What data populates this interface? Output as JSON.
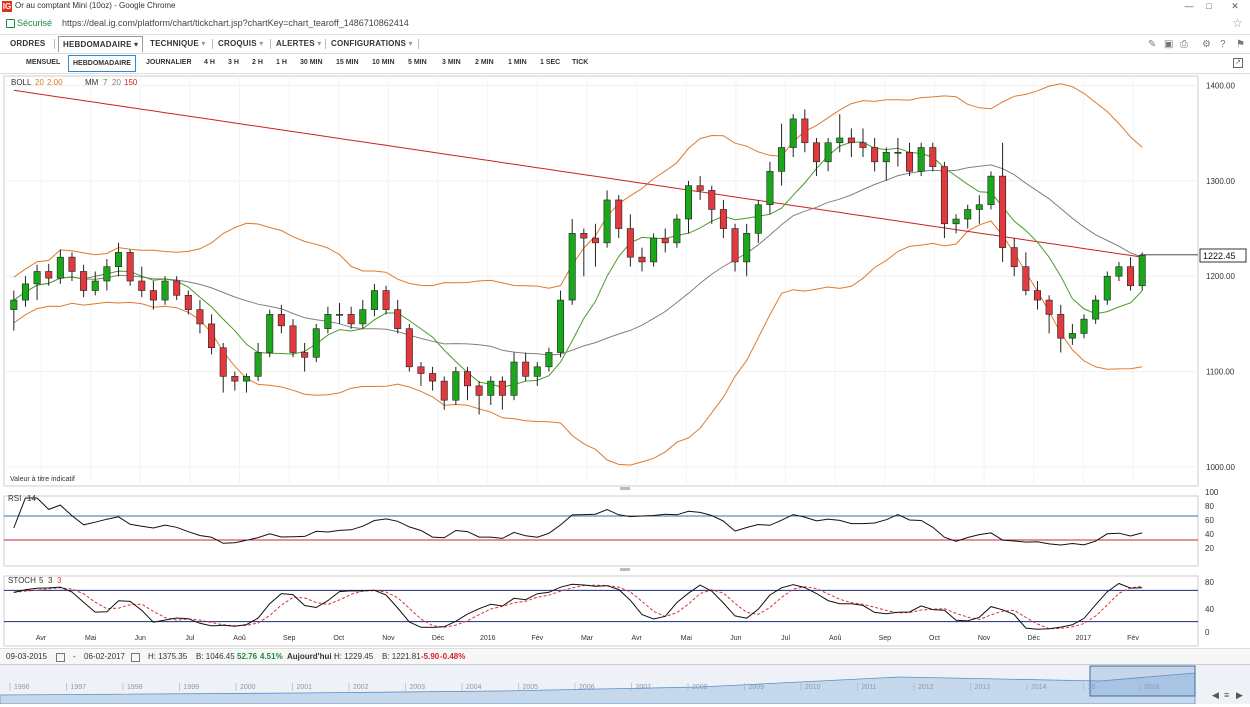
{
  "browser": {
    "title": "Or au comptant Mini (10oz) - Google Chrome",
    "secure_label": "Sécurisé",
    "url": "https://deal.ig.com/platform/chart/tickchart.jsp?chartKey=chart_tearoff_1486710862414",
    "logo": "IG"
  },
  "menu": {
    "items": [
      "ORDRES",
      "HEBDOMADAIRE",
      "TECHNIQUE",
      "CROQUIS",
      "ALERTES",
      "CONFIGURATIONS"
    ],
    "selected": "HEBDOMADAIRE",
    "right_icons": [
      "pencil-icon",
      "image-icon",
      "print-icon",
      "gear-icon",
      "help-icon",
      "comment-icon"
    ]
  },
  "timeframes": {
    "items": [
      "MENSUEL",
      "HEBDOMADAIRE",
      "JOURNALIER",
      "4 H",
      "3 H",
      "2 H",
      "1 H",
      "30 MIN",
      "15 MIN",
      "10 MIN",
      "5 MIN",
      "3 MIN",
      "2 MIN",
      "1 MIN",
      "1 SEC",
      "TICK"
    ],
    "selected": "HEBDOMADAIRE"
  },
  "chart_data": {
    "type": "candlestick",
    "instrument": "Or au comptant Mini (10oz)",
    "period": "weekly",
    "indicators_label": {
      "boll": {
        "name": "BOLL",
        "params": [
          "20",
          "2.00"
        ]
      },
      "mm": {
        "name": "MM",
        "params": [
          "7",
          "20",
          "150"
        ]
      }
    },
    "y_ticks": [
      "1400.00",
      "1300.00",
      "1200.00",
      "1100.00",
      "1000.00"
    ],
    "ylim": [
      980,
      1410
    ],
    "last_price": "1222.45",
    "last_value": 1222.45,
    "x_ticks": [
      "Avr",
      "Mai",
      "Jun",
      "Jul",
      "Aoû",
      "Sep",
      "Oct",
      "Nov",
      "Déc",
      "2016",
      "Fév",
      "Mar",
      "Avr",
      "Mai",
      "Jun",
      "Jul",
      "Aoû",
      "Sep",
      "Oct",
      "Nov",
      "Déc",
      "2017",
      "Fév"
    ],
    "footnote": "Valeur à titre indicatif",
    "candles": [
      [
        1165,
        1185,
        1143,
        1175
      ],
      [
        1175,
        1200,
        1168,
        1192
      ],
      [
        1192,
        1212,
        1175,
        1205
      ],
      [
        1205,
        1213,
        1190,
        1198
      ],
      [
        1198,
        1228,
        1192,
        1220
      ],
      [
        1220,
        1225,
        1195,
        1205
      ],
      [
        1205,
        1212,
        1178,
        1185
      ],
      [
        1185,
        1205,
        1180,
        1195
      ],
      [
        1195,
        1218,
        1185,
        1210
      ],
      [
        1210,
        1235,
        1200,
        1225
      ],
      [
        1225,
        1228,
        1190,
        1195
      ],
      [
        1195,
        1210,
        1178,
        1185
      ],
      [
        1185,
        1195,
        1165,
        1175
      ],
      [
        1175,
        1200,
        1170,
        1195
      ],
      [
        1195,
        1200,
        1175,
        1180
      ],
      [
        1180,
        1185,
        1160,
        1165
      ],
      [
        1165,
        1175,
        1140,
        1150
      ],
      [
        1150,
        1160,
        1118,
        1125
      ],
      [
        1125,
        1130,
        1078,
        1095
      ],
      [
        1095,
        1100,
        1080,
        1090
      ],
      [
        1090,
        1098,
        1078,
        1095
      ],
      [
        1095,
        1130,
        1090,
        1120
      ],
      [
        1120,
        1165,
        1115,
        1160
      ],
      [
        1160,
        1170,
        1140,
        1148
      ],
      [
        1148,
        1155,
        1115,
        1120
      ],
      [
        1120,
        1130,
        1100,
        1115
      ],
      [
        1115,
        1150,
        1110,
        1145
      ],
      [
        1145,
        1168,
        1140,
        1160
      ],
      [
        1160,
        1172,
        1150,
        1160
      ],
      [
        1160,
        1168,
        1145,
        1150
      ],
      [
        1150,
        1175,
        1145,
        1165
      ],
      [
        1165,
        1192,
        1158,
        1185
      ],
      [
        1185,
        1190,
        1160,
        1165
      ],
      [
        1165,
        1175,
        1140,
        1145
      ],
      [
        1145,
        1150,
        1100,
        1105
      ],
      [
        1105,
        1110,
        1085,
        1098
      ],
      [
        1098,
        1105,
        1080,
        1090
      ],
      [
        1090,
        1095,
        1060,
        1070
      ],
      [
        1070,
        1105,
        1065,
        1100
      ],
      [
        1100,
        1105,
        1070,
        1085
      ],
      [
        1085,
        1090,
        1055,
        1075
      ],
      [
        1075,
        1095,
        1065,
        1090
      ],
      [
        1090,
        1095,
        1060,
        1075
      ],
      [
        1075,
        1120,
        1070,
        1110
      ],
      [
        1110,
        1120,
        1090,
        1095
      ],
      [
        1095,
        1110,
        1085,
        1105
      ],
      [
        1105,
        1125,
        1100,
        1120
      ],
      [
        1120,
        1185,
        1115,
        1175
      ],
      [
        1175,
        1260,
        1170,
        1245
      ],
      [
        1245,
        1250,
        1200,
        1240
      ],
      [
        1240,
        1255,
        1210,
        1235
      ],
      [
        1235,
        1290,
        1230,
        1280
      ],
      [
        1280,
        1285,
        1240,
        1250
      ],
      [
        1250,
        1265,
        1210,
        1220
      ],
      [
        1220,
        1230,
        1205,
        1215
      ],
      [
        1215,
        1245,
        1210,
        1240
      ],
      [
        1240,
        1250,
        1225,
        1235
      ],
      [
        1235,
        1265,
        1230,
        1260
      ],
      [
        1260,
        1300,
        1245,
        1295
      ],
      [
        1295,
        1305,
        1280,
        1290
      ],
      [
        1290,
        1295,
        1255,
        1270
      ],
      [
        1270,
        1280,
        1240,
        1250
      ],
      [
        1250,
        1255,
        1205,
        1215
      ],
      [
        1215,
        1255,
        1200,
        1245
      ],
      [
        1245,
        1280,
        1235,
        1275
      ],
      [
        1275,
        1320,
        1265,
        1310
      ],
      [
        1310,
        1360,
        1295,
        1335
      ],
      [
        1335,
        1370,
        1325,
        1365
      ],
      [
        1365,
        1375,
        1330,
        1340
      ],
      [
        1340,
        1345,
        1305,
        1320
      ],
      [
        1320,
        1345,
        1310,
        1340
      ],
      [
        1340,
        1370,
        1330,
        1345
      ],
      [
        1345,
        1355,
        1325,
        1340
      ],
      [
        1340,
        1355,
        1325,
        1335
      ],
      [
        1335,
        1345,
        1310,
        1320
      ],
      [
        1320,
        1335,
        1300,
        1330
      ],
      [
        1330,
        1345,
        1315,
        1330
      ],
      [
        1330,
        1340,
        1305,
        1310
      ],
      [
        1310,
        1340,
        1305,
        1335
      ],
      [
        1335,
        1340,
        1310,
        1315
      ],
      [
        1315,
        1320,
        1240,
        1255
      ],
      [
        1255,
        1265,
        1245,
        1260
      ],
      [
        1260,
        1275,
        1250,
        1270
      ],
      [
        1270,
        1285,
        1255,
        1275
      ],
      [
        1275,
        1310,
        1270,
        1305
      ],
      [
        1305,
        1340,
        1215,
        1230
      ],
      [
        1230,
        1240,
        1200,
        1210
      ],
      [
        1210,
        1225,
        1180,
        1185
      ],
      [
        1185,
        1195,
        1165,
        1175
      ],
      [
        1175,
        1180,
        1140,
        1160
      ],
      [
        1160,
        1170,
        1120,
        1135
      ],
      [
        1135,
        1150,
        1128,
        1140
      ],
      [
        1140,
        1160,
        1135,
        1155
      ],
      [
        1155,
        1180,
        1150,
        1175
      ],
      [
        1175,
        1205,
        1170,
        1200
      ],
      [
        1200,
        1215,
        1195,
        1210
      ],
      [
        1210,
        1220,
        1185,
        1190
      ],
      [
        1190,
        1225,
        1185,
        1222
      ]
    ],
    "rsi": {
      "label": "RSI",
      "period": "14",
      "ylim": [
        0,
        100
      ],
      "levels": [
        30,
        70
      ],
      "ticks": [
        "100",
        "80",
        "60",
        "40",
        "20"
      ]
    },
    "stoch": {
      "label": "STOCH",
      "params": [
        "5",
        "3",
        "3"
      ],
      "ylim": [
        0,
        100
      ],
      "levels": [
        20,
        80
      ],
      "ticks": [
        "80",
        "40",
        "0"
      ]
    }
  },
  "status": {
    "from": "09-03-2015",
    "to": "06-02-2017",
    "high": "H: 1375.35",
    "low": "B: 1046.45",
    "change_abs": "52.76",
    "change_pct": "4.51%",
    "today_label": "Aujourd'hui :",
    "today_high": "H: 1229.45",
    "today_low": "B: 1221.81",
    "today_change": "-5.90",
    "today_change_pct": "-0.48%"
  },
  "navigator": {
    "years": [
      "1996",
      "1997",
      "1998",
      "1999",
      "2000",
      "2001",
      "2002",
      "2003",
      "2004",
      "2005",
      "2006",
      "2007",
      "2008",
      "2009",
      "2010",
      "2011",
      "2012",
      "2013",
      "2014",
      "15",
      "2016"
    ]
  },
  "colors": {
    "up": "#1aa81a",
    "down": "#e0393e",
    "boll": "#e07a2a",
    "mm_fast": "#4a9a2a",
    "mm_mid": "#808080",
    "mm_slow": "#cc2222",
    "rsi": "#111111",
    "stoch_k": "#111111",
    "stoch_d": "#e03030",
    "upper_level": "#2a7a9a",
    "lower_level": "#cc2233"
  }
}
